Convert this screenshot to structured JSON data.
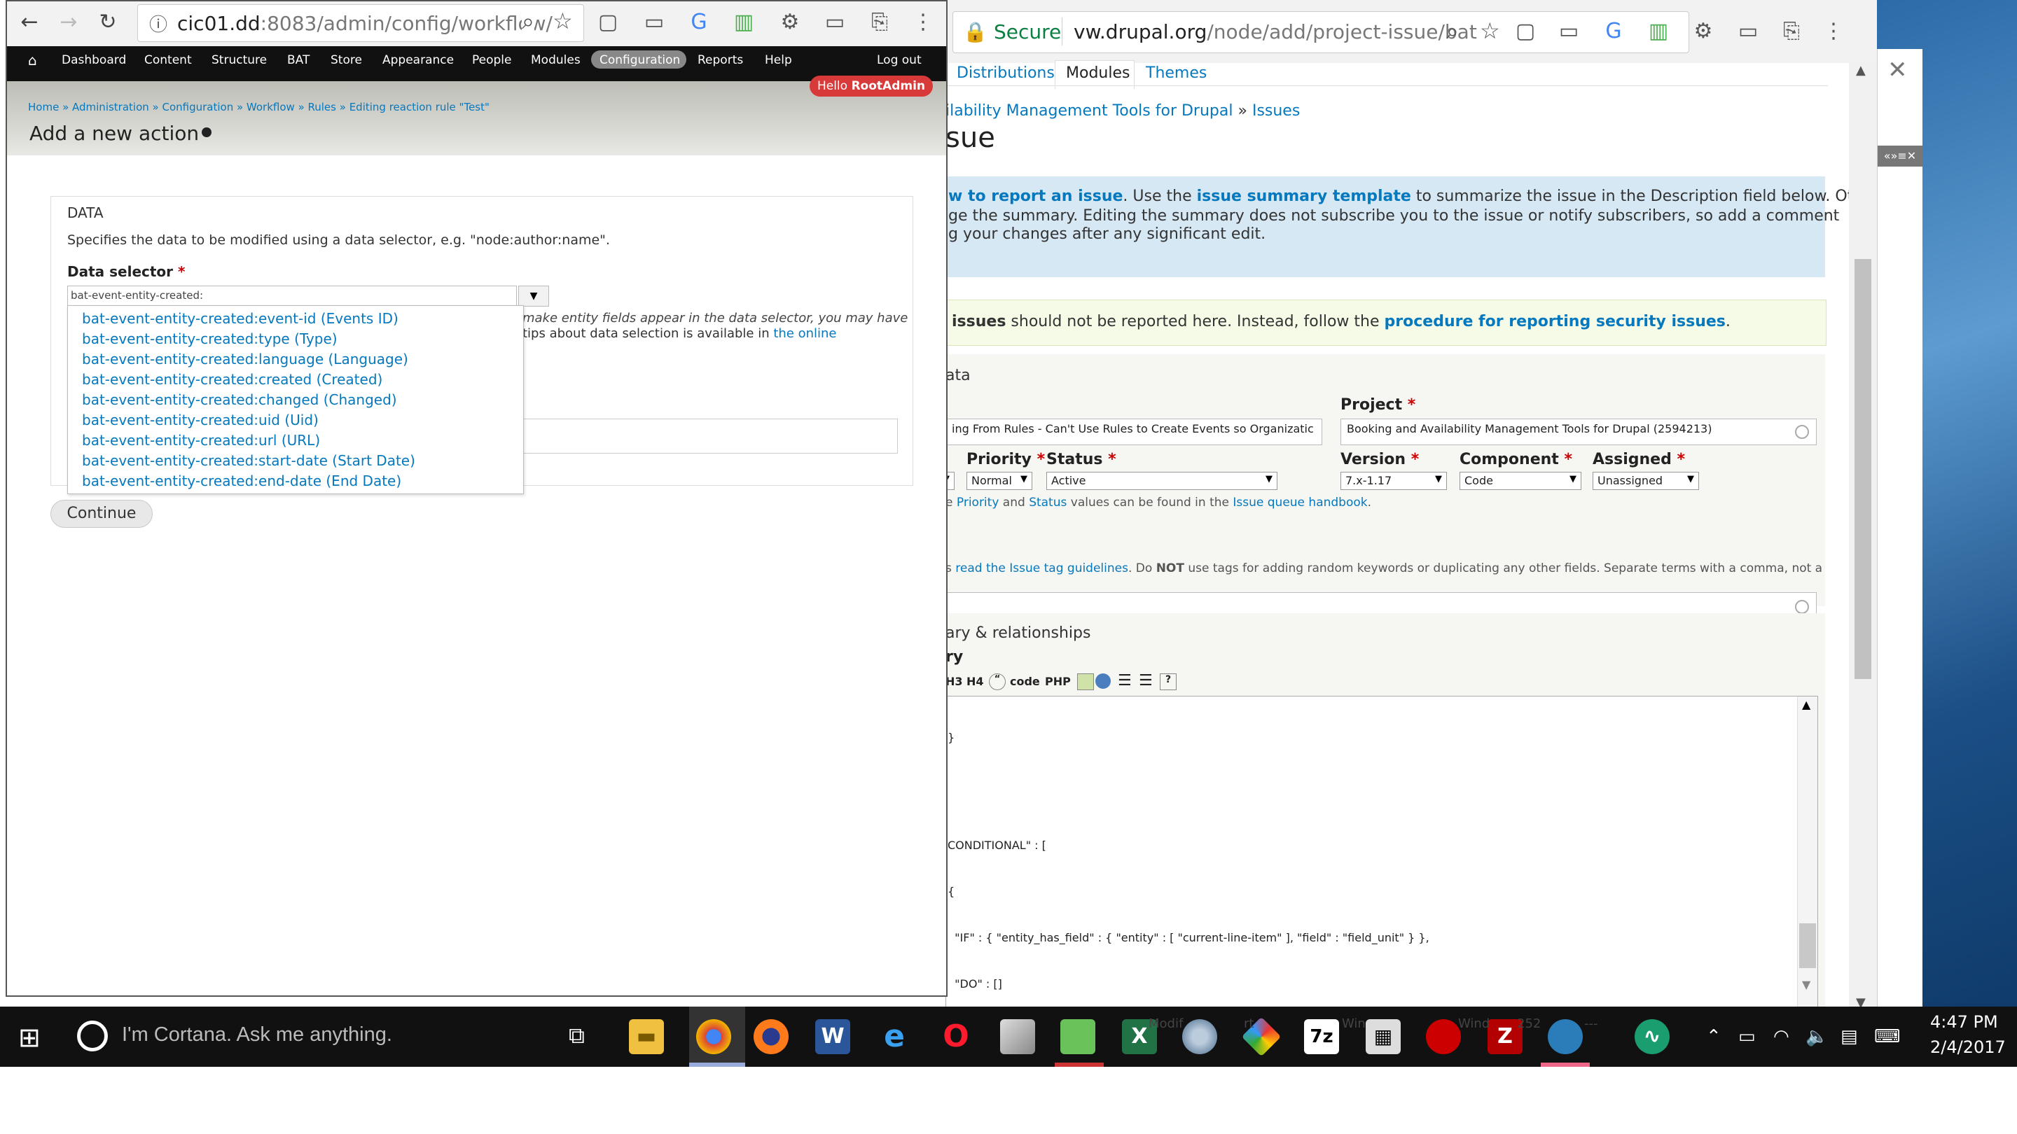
{
  "left_browser": {
    "url_host": "cic01.dd",
    "url_rest": ":8083/admin/config/workflow/",
    "admin_menu": [
      "Dashboard",
      "Content",
      "Structure",
      "BAT",
      "Store",
      "Appearance",
      "People",
      "Modules",
      "Configuration",
      "Reports",
      "Help"
    ],
    "logout": "Log out",
    "hello_prefix": "Hello",
    "hello_user": "RootAdmin",
    "breadcrumb": "Home » Administration » Configuration » Workflow » Rules » Editing reaction rule \"Test\"",
    "page_title": "Add a new action",
    "fieldset_legend": "DATA",
    "fieldset_desc": "Specifies the data to be modified using a data selector, e.g. \"node:author:name\".",
    "selector_label": "Data selector",
    "selector_value": "bat-event-entity-created:",
    "hint_line1": "make entity fields appear in the data selector, you may have",
    "hint_line2_a": "tips about data selection is available in",
    "hint_line2_link": "the online",
    "dropdown": [
      "bat-event-entity-created:event-id (Events ID)",
      "bat-event-entity-created:type (Type)",
      "bat-event-entity-created:language (Language)",
      "bat-event-entity-created:created (Created)",
      "bat-event-entity-created:changed (Changed)",
      "bat-event-entity-created:uid (Uid)",
      "bat-event-entity-created:url (URL)",
      "bat-event-entity-created:start-date (Start Date)",
      "bat-event-entity-created:end-date (End Date)"
    ],
    "continue_btn": "Continue"
  },
  "right_browser": {
    "secure": "Secure",
    "url_host": "vw.drupal.org",
    "url_rest": "/node/add/project-issue/bat",
    "tabs": [
      "Distributions",
      "Modules",
      "Themes"
    ],
    "breadcrumb_a": "ilability Management Tools for Drupal",
    "breadcrumb_sep": "»",
    "breadcrumb_b": "Issues",
    "page_title": "sue",
    "info_line1_a": "w to report an issue",
    "info_line1_b": ". Use the ",
    "info_line1_link": "issue summary template",
    "info_line1_c": " to summarize the issue in the Description field below. Others can",
    "info_line2": "ge the summary. Editing the summary does not subscribe you to the issue or notify subscribers, so add a comment",
    "info_line3": "g your changes after any significant edit.",
    "warn_bold": "issues",
    "warn_text": " should not be reported here. Instead, follow the ",
    "warn_link": "procedure for reporting security issues",
    "warn_end": ".",
    "section_meta": "ata",
    "project_label": "Project",
    "title_value": "ing From Rules - Can't Use Rules to Create Events so Organizatic",
    "project_value": "Booking and Availability Management Tools for Drupal (2594213)",
    "priority_label": "Priority",
    "status_label": "Status",
    "version_label": "Version",
    "component_label": "Component",
    "assigned_label": "Assigned",
    "priority_value": "Normal",
    "status_value": "Active",
    "version_value": "7.x-1.17",
    "component_value": "Code",
    "assigned_value": "Unassigned",
    "values_note_a": "e ",
    "values_note_priority": "Priority",
    "values_note_and": " and ",
    "values_note_status": "Status",
    "values_note_b": " values can be found in the ",
    "values_note_link": "Issue queue handbook",
    "values_note_end": ".",
    "tags_note_a": "s ",
    "tags_note_link": "read the Issue tag guidelines",
    "tags_note_b": ". Do ",
    "tags_note_not": "NOT",
    "tags_note_c": " use tags for adding random keywords or duplicating any other fields. Separate terms with a comma, not a",
    "summary_section": "ary & relationships",
    "summary_label": "ry",
    "editor_buttons": [
      "H3",
      "H4",
      "code",
      "PHP"
    ],
    "code_lines": [
      "}",
      "",
      "",
      "CONDITIONAL\" : [",
      "{",
      "  \"IF\" : { \"entity_has_field\" : { \"entity\" : [ \"current-line-item\" ], \"field\" : \"field_unit\" } },",
      "  \"DO\" : []",
      "}"
    ]
  },
  "taskbar": {
    "cortana": "I'm Cortana. Ask me anything.",
    "time": "4:47 PM",
    "date": "2/4/2017",
    "ghost_text_a": "Modif",
    "ghost_text_b": "rt",
    "ghost_text_c": "Win",
    "ghost_text_d": "Wind",
    "ghost_text_e": "252",
    "ghost_text_f": "---"
  },
  "colors": {
    "drupal_blue": "#0678be",
    "admin_bar": "#111111",
    "hello_badge": "#d83a3a",
    "taskbar": "#111111",
    "required": "#cc0000"
  }
}
